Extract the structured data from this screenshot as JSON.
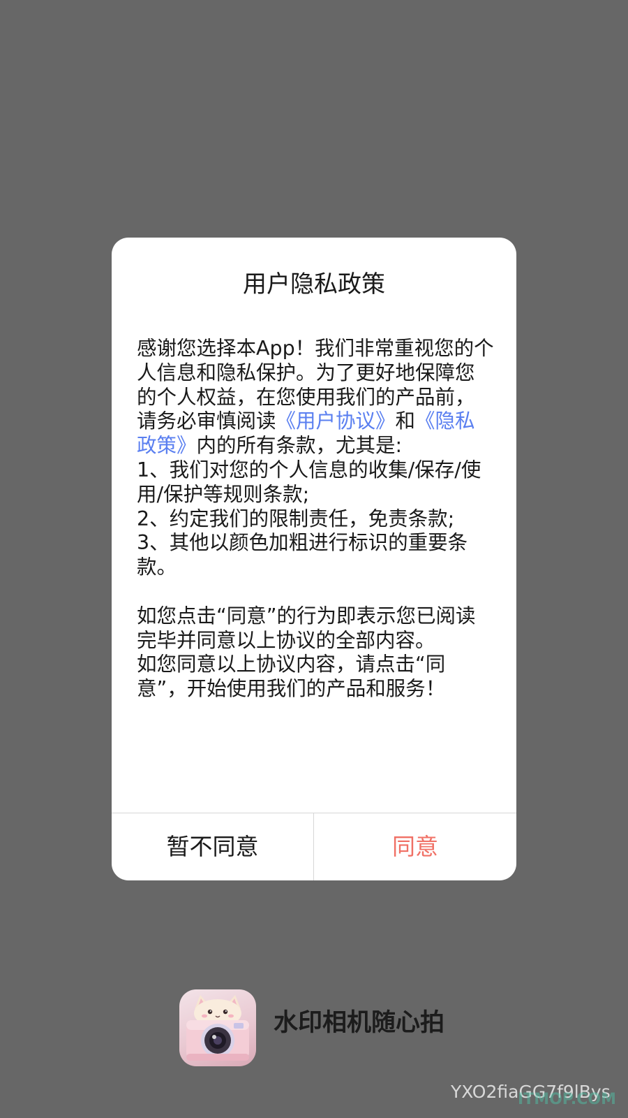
{
  "dialog": {
    "title": "用户隐私政策",
    "body": {
      "intro": "感谢您选择本App！我们非常重视您的个人信息和隐私保护。为了更好地保障您的个人权益，在您使用我们的产品前，请务必审慎阅读",
      "link_user_agreement": "《用户协议》",
      "and": "和",
      "link_privacy_policy": "《隐私政策》",
      "after_links": "内的所有条款，尤其是:",
      "item1": "1、我们对您的个人信息的收集/保存/使用/保护等规则条款;",
      "item2": "2、约定我们的限制责任，免责条款;",
      "item3": "3、其他以颜色加粗进行标识的重要条款。",
      "para2": "如您点击“同意”的行为即表示您已阅读完毕并同意以上协议的全部内容。",
      "para3": "如您同意以上协议内容，请点击“同意”，开始使用我们的产品和服务！"
    },
    "buttons": {
      "decline": "暂不同意",
      "agree": "同意"
    }
  },
  "app": {
    "name": "水印相机随心拍",
    "icon": "camera-cat-app-icon"
  },
  "watermark": {
    "code": "YXO2fiaGG7f9lBys",
    "site": "ITMOP.COM"
  },
  "colors": {
    "overlay": "#676767",
    "link": "#5a7ff0",
    "agree": "#f07065"
  }
}
